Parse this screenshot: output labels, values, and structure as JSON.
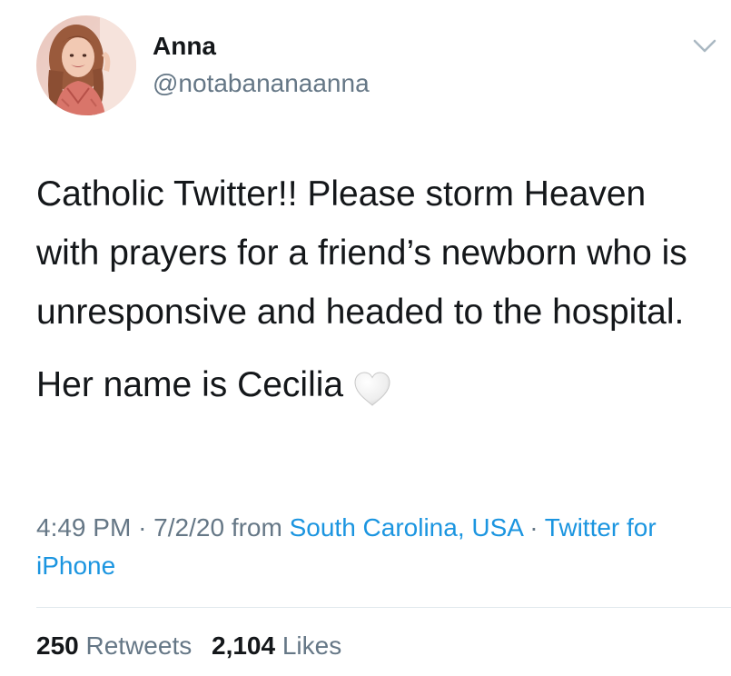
{
  "tweet": {
    "author": {
      "name": "Anna",
      "handle": "@notabananaanna",
      "avatar_icon": "profile-photo"
    },
    "menu_icon": "chevron-down-icon",
    "text": {
      "paragraph1": "Catholic Twitter!! Please storm Heaven with prayers for a friend’s newborn who is unresponsive and headed to the hospital.",
      "paragraph2": "Her name is Cecilia",
      "emoji": "white-heart-icon"
    },
    "meta": {
      "time": "4:49 PM",
      "date": "7/2/20",
      "from_label": "from",
      "location": "South Carolina, USA",
      "source": "Twitter for iPhone",
      "separator": "·"
    },
    "stats": {
      "retweets_count": "250",
      "retweets_label": "Retweets",
      "likes_count": "2,104",
      "likes_label": "Likes"
    }
  },
  "colors": {
    "text_primary": "#14171a",
    "text_secondary": "#657786",
    "link": "#1b95e0",
    "divider": "#e1e8ed",
    "background": "#ffffff"
  }
}
